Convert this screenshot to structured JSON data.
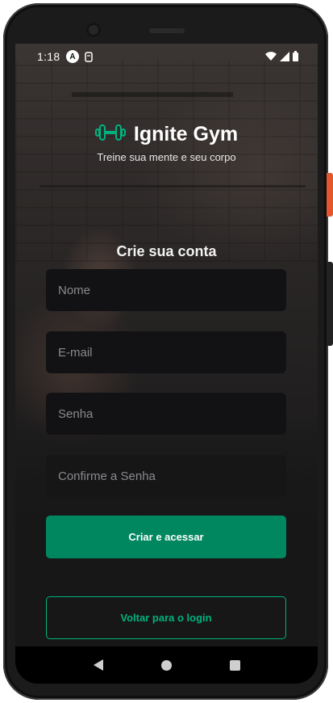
{
  "status_bar": {
    "time": "1:18",
    "left_icons": [
      "a-circle-icon",
      "sim-icon"
    ],
    "right_icons": [
      "wifi-icon",
      "signal-icon",
      "battery-icon"
    ]
  },
  "brand": {
    "title": "Ignite Gym",
    "tagline": "Treine sua mente e seu corpo",
    "logo_icon": "dumbbell-icon",
    "accent": "#00b37e"
  },
  "form": {
    "heading": "Crie sua conta",
    "fields": [
      {
        "placeholder": "Nome",
        "value": ""
      },
      {
        "placeholder": "E-mail",
        "value": ""
      },
      {
        "placeholder": "Senha",
        "value": ""
      },
      {
        "placeholder": "Confirme a Senha",
        "value": ""
      }
    ],
    "submit_label": "Criar e acessar",
    "back_label": "Voltar para o login"
  },
  "colors": {
    "primary_button": "#00875f",
    "outline_button": "#00b37e",
    "input_bg": "#121214"
  },
  "nav": {
    "icons": [
      "back-icon",
      "home-icon",
      "recents-icon"
    ]
  }
}
